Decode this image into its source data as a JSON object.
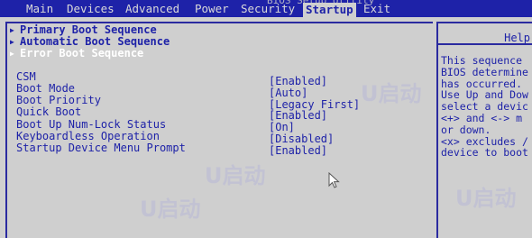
{
  "titlebar": {
    "tabs": [
      "Main",
      "Devices",
      "Advanced",
      "Power",
      "Security",
      "Startup",
      "Exit"
    ],
    "active_tab": "Startup",
    "window_title_fragment": "BIOS Setup Utility"
  },
  "sequences": [
    {
      "label": "Primary Boot Sequence",
      "selected": false
    },
    {
      "label": "Automatic Boot Sequence",
      "selected": false
    },
    {
      "label": "Error Boot Sequence",
      "selected": true
    }
  ],
  "settings": [
    {
      "label": "CSM",
      "value": "[Enabled]"
    },
    {
      "label": "Boot Mode",
      "value": "[Auto]"
    },
    {
      "label": "Boot Priority",
      "value": "[Legacy First]"
    },
    {
      "label": "Quick Boot",
      "value": "[Enabled]"
    },
    {
      "label": "Boot Up Num-Lock Status",
      "value": "[On]"
    },
    {
      "label": "Keyboardless Operation",
      "value": "[Disabled]"
    },
    {
      "label": "Startup Device Menu Prompt",
      "value": "[Enabled]"
    }
  ],
  "help": {
    "title": "Help",
    "lines": [
      "This sequence",
      "BIOS determine",
      "has occurred.",
      "Use Up and Dow",
      "select a devic",
      "<+> and <-> m",
      "or down.",
      "<x> excludes /",
      "device to boot"
    ]
  },
  "watermarks": [
    "U启动",
    "U启动",
    "U启动",
    "U启动"
  ],
  "colors": {
    "background": "#cfcfcf",
    "accent": "#1e22a8",
    "selected_text": "#ffffff"
  }
}
